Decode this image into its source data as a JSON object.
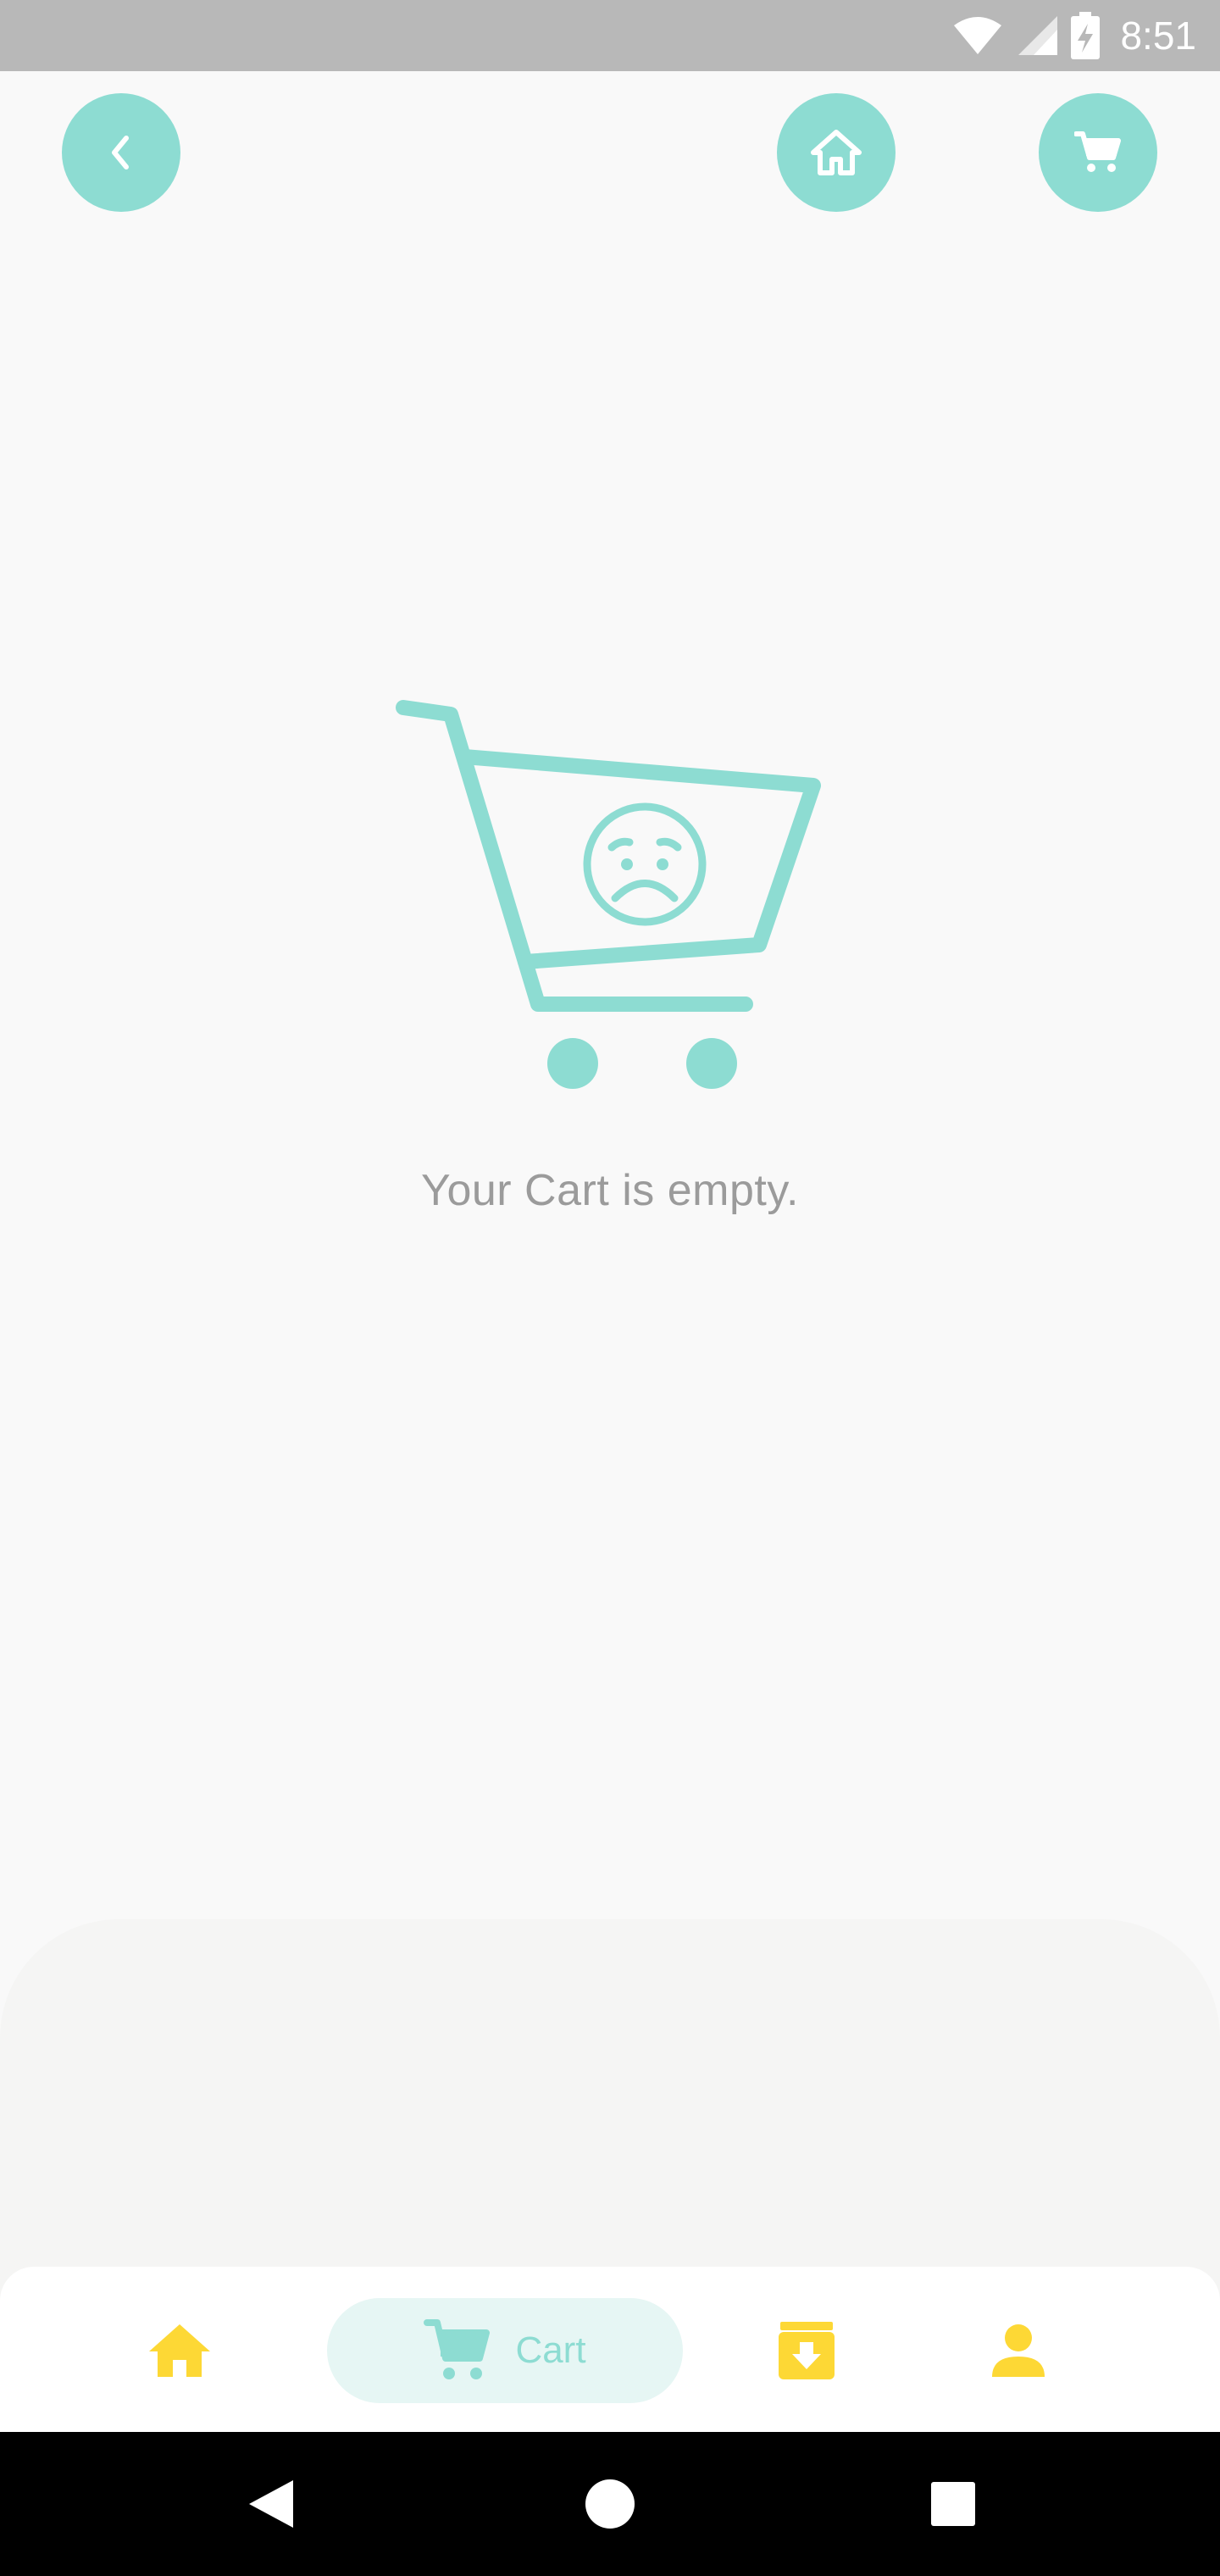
{
  "status_bar": {
    "time": "8:51",
    "icons": [
      "wifi-icon",
      "signal-icon",
      "battery-charging-icon"
    ]
  },
  "header": {
    "buttons": [
      {
        "name": "back-button",
        "icon": "chevron-left-icon"
      },
      {
        "name": "home-button",
        "icon": "home-icon"
      },
      {
        "name": "cart-button",
        "icon": "cart-icon"
      }
    ]
  },
  "main": {
    "illustration": "empty-cart-sad-face",
    "empty_message": "Your Cart is empty."
  },
  "bottom_nav": {
    "items": [
      {
        "name": "nav-home",
        "icon": "home-icon"
      },
      {
        "name": "nav-cart",
        "icon": "cart-icon",
        "label": "Cart",
        "active": true
      },
      {
        "name": "nav-orders",
        "icon": "archive-download-icon"
      },
      {
        "name": "nav-profile",
        "icon": "person-icon"
      }
    ]
  },
  "system_nav": {
    "buttons": [
      "back-triangle-icon",
      "home-circle-icon",
      "recents-square-icon"
    ]
  },
  "colors": {
    "accent": "#8ddcd2",
    "accent_light": "#e6f6f4",
    "nav_icon": "#fdd835",
    "status_bar": "#b8b8b8",
    "text_muted": "#9b9b9b",
    "background": "#f9f9f9"
  }
}
